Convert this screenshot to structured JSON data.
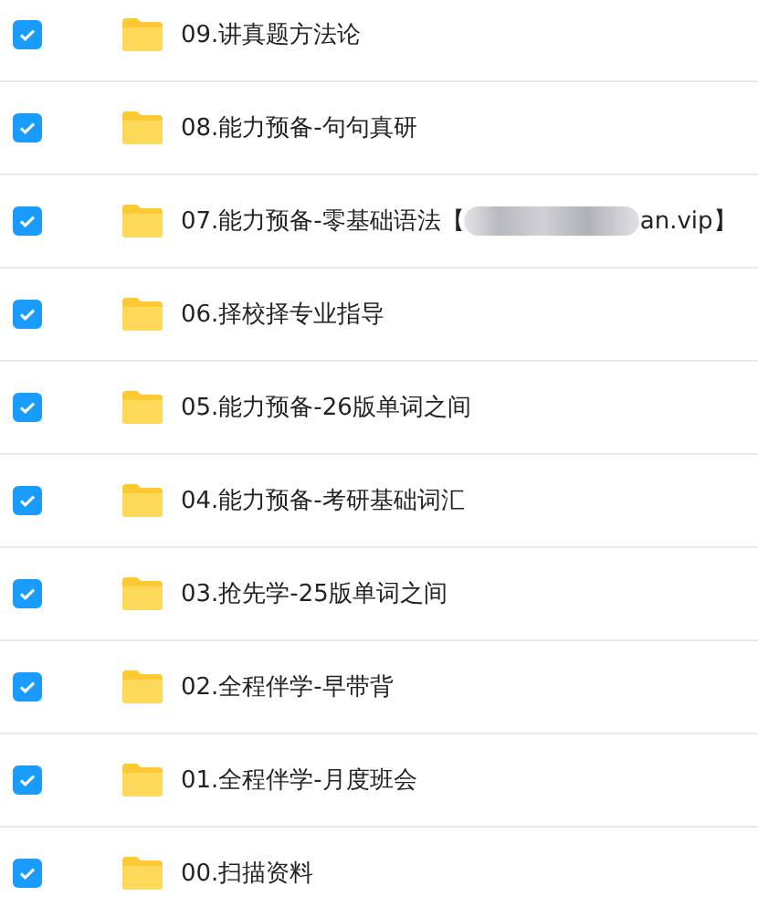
{
  "files": [
    {
      "name": "09.讲真题方法论",
      "checked": true
    },
    {
      "name": "08.能力预备-句句真研",
      "checked": true
    },
    {
      "name": "07.能力预备-零基础语法【",
      "redacted": true,
      "name_tail": "an.vip】",
      "checked": true
    },
    {
      "name": "06.择校择专业指导",
      "checked": true
    },
    {
      "name": "05.能力预备-26版单词之间",
      "checked": true
    },
    {
      "name": "04.能力预备-考研基础词汇",
      "checked": true
    },
    {
      "name": "03.抢先学-25版单词之间",
      "checked": true
    },
    {
      "name": "02.全程伴学-早带背",
      "checked": true
    },
    {
      "name": "01.全程伴学-月度班会",
      "checked": true
    },
    {
      "name": "00.扫描资料",
      "checked": true
    }
  ]
}
